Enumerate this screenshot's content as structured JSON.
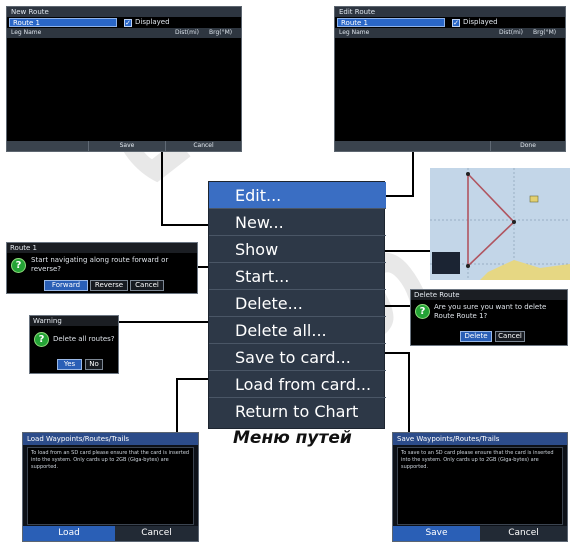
{
  "screen_new": {
    "title": "New Route",
    "route_name": "Route 1",
    "displayed_label": "Displayed",
    "col_leg": "Leg Name",
    "col_dist": "Dist(mi)",
    "col_brg": "Brg(°M)",
    "btn_save": "Save",
    "btn_cancel": "Cancel"
  },
  "screen_edit": {
    "title": "Edit Route",
    "route_name": "Route 1",
    "displayed_label": "Displayed",
    "col_leg": "Leg Name",
    "col_dist": "Dist(mi)",
    "col_brg": "Brg(°M)",
    "btn_done": "Done"
  },
  "menu": {
    "items": [
      "Edit...",
      "New...",
      "Show",
      "Start...",
      "Delete...",
      "Delete all...",
      "Save to card...",
      "Load from card...",
      "Return to Chart"
    ],
    "caption": "Меню путей"
  },
  "dlg_start": {
    "title": "Route 1",
    "text": "Start navigating along route forward or reverse?",
    "btn_forward": "Forward",
    "btn_reverse": "Reverse",
    "btn_cancel": "Cancel"
  },
  "dlg_warning": {
    "title": "Warning",
    "text": "Delete all routes?",
    "btn_yes": "Yes",
    "btn_no": "No"
  },
  "dlg_delete": {
    "title": "Delete Route",
    "text": "Are you sure you want to delete Route Route 1?",
    "btn_delete": "Delete",
    "btn_cancel": "Cancel"
  },
  "panel_load": {
    "title": "Load Waypoints/Routes/Trails",
    "text": "To load from an SD card please ensure that the card is inserted into the system. Only cards up to 2GB (Giga-bytes) are supported.",
    "btn_load": "Load",
    "btn_cancel": "Cancel"
  },
  "panel_save": {
    "title": "Save Waypoints/Routes/Trails",
    "text": "To save to an SD card please ensure that the card is inserted into the system. Only cards up to 2GB (Giga-bytes) are supported.",
    "btn_save": "Save",
    "btn_cancel": "Cancel"
  },
  "map_preview": {
    "accent": "#c3d6e8"
  },
  "colors": {
    "accent": "#3a6ec3",
    "menu_bg": "#2d3847",
    "ok_green": "#24a336"
  }
}
